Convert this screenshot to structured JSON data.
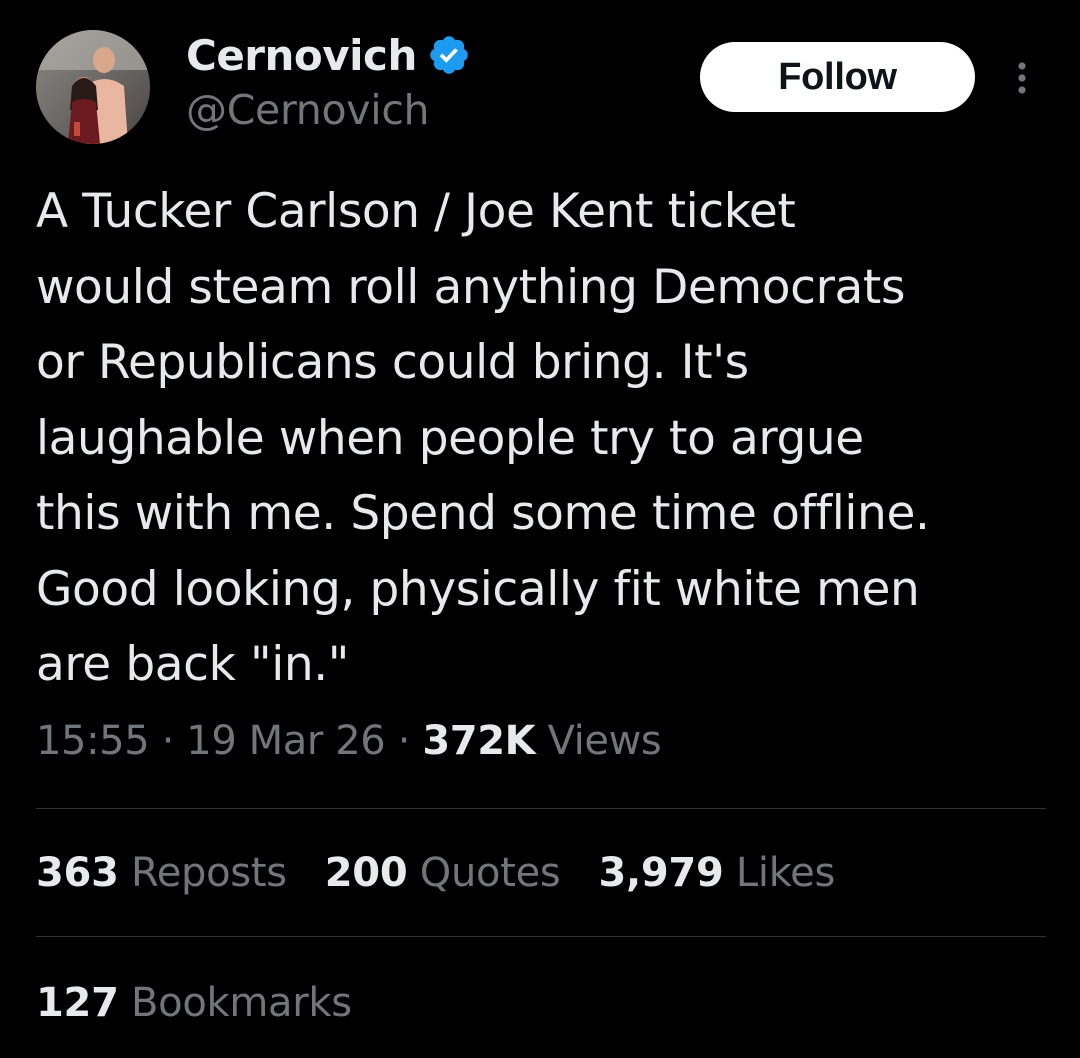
{
  "author": {
    "display_name": "Cernovich",
    "handle": "@Cernovich",
    "verified": true,
    "verified_icon": "verified-badge-icon",
    "verified_color": "#1d9bf0"
  },
  "header": {
    "follow_label": "Follow",
    "more_icon": "more-vertical-icon"
  },
  "tweet": {
    "text_lines": [
      "A Tucker Carlson / Joe Kent ticket",
      "would steam roll anything Democrats",
      "or Republicans could bring. It's",
      "laughable when people try to argue",
      "this with me. Spend some time offline.",
      "Good looking, physically fit white men",
      "are back \"in.\""
    ],
    "time": "15:55",
    "date": "19 Mar 26",
    "separator": "·",
    "views_count": "372K",
    "views_label": "Views"
  },
  "stats": {
    "reposts": {
      "count": "363",
      "label": "Reposts"
    },
    "quotes": {
      "count": "200",
      "label": "Quotes"
    },
    "likes": {
      "count": "3,979",
      "label": "Likes"
    },
    "bookmarks": {
      "count": "127",
      "label": "Bookmarks"
    }
  },
  "colors": {
    "background": "#000000",
    "text_primary": "#e7e9ea",
    "text_secondary": "#71767b",
    "divider": "#2f3336",
    "button_bg": "#ffffff",
    "button_text": "#0f1419"
  }
}
